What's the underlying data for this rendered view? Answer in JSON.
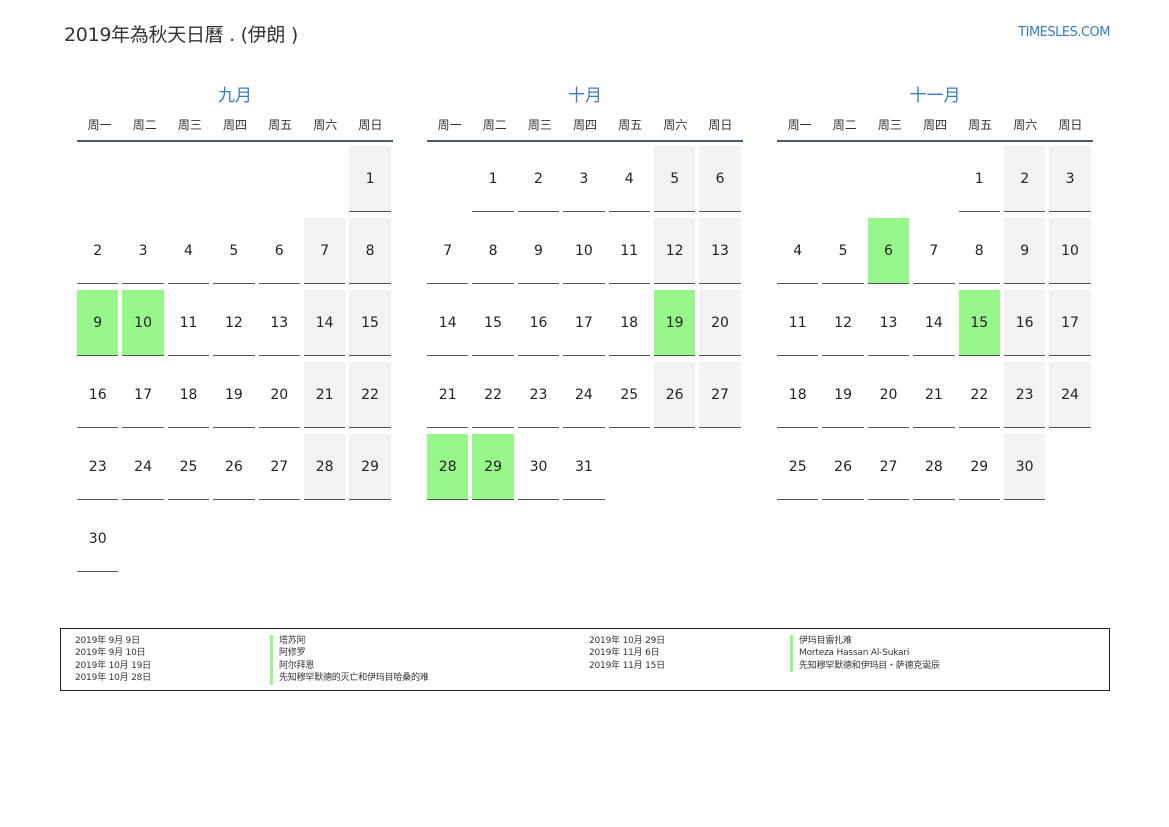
{
  "header": {
    "title": "2019年為秋天日曆 . (伊朗 )",
    "site": "TIMESLES.COM"
  },
  "weekdays": [
    "周一",
    "周二",
    "周三",
    "周四",
    "周五",
    "周六",
    "周日"
  ],
  "colors": {
    "accent": "#3a7cc1",
    "holiday": "#98f78a",
    "weekend": "#f2f2f2"
  },
  "months": [
    {
      "name": "九月",
      "offset": 6,
      "days": [
        "1",
        "2",
        "3",
        "4",
        "5",
        "6",
        "7",
        "8",
        "9",
        "10",
        "11",
        "12",
        "13",
        "14",
        "15",
        "16",
        "17",
        "18",
        "19",
        "20",
        "21",
        "22",
        "23",
        "24",
        "25",
        "26",
        "27",
        "28",
        "29",
        "30"
      ],
      "holidays": [
        "9",
        "10"
      ]
    },
    {
      "name": "十月",
      "offset": 1,
      "days": [
        "1",
        "2",
        "3",
        "4",
        "5",
        "6",
        "7",
        "8",
        "9",
        "10",
        "11",
        "12",
        "13",
        "14",
        "15",
        "16",
        "17",
        "18",
        "19",
        "20",
        "21",
        "22",
        "23",
        "24",
        "25",
        "26",
        "27",
        "28",
        "29",
        "30",
        "31"
      ],
      "holidays": [
        "19",
        "28",
        "29"
      ]
    },
    {
      "name": "十一月",
      "offset": 4,
      "days": [
        "1",
        "2",
        "3",
        "4",
        "5",
        "6",
        "7",
        "8",
        "9",
        "10",
        "11",
        "12",
        "13",
        "14",
        "15",
        "16",
        "17",
        "18",
        "19",
        "20",
        "21",
        "22",
        "23",
        "24",
        "25",
        "26",
        "27",
        "28",
        "29",
        "30"
      ],
      "holidays": [
        "6",
        "15"
      ]
    }
  ],
  "legend": [
    [
      {
        "date": "2019年 9月 9日",
        "name": "塔苏阿"
      },
      {
        "date": "2019年 9月 10日",
        "name": "阿修罗"
      },
      {
        "date": "2019年 10月 19日",
        "name": "阿尔拜恩"
      },
      {
        "date": "2019年 10月 28日",
        "name": "先知穆罕默德的灭亡和伊玛目哈桑的难"
      }
    ],
    [
      {
        "date": "2019年 10月 29日",
        "name": "伊玛目雷扎难"
      },
      {
        "date": "2019年 11月 6日",
        "name": "Morteza Hassan Al-Sukari"
      },
      {
        "date": "2019年 11月 15日",
        "name": "先知穆罕默德和伊玛目・萨德克诞辰"
      }
    ]
  ]
}
